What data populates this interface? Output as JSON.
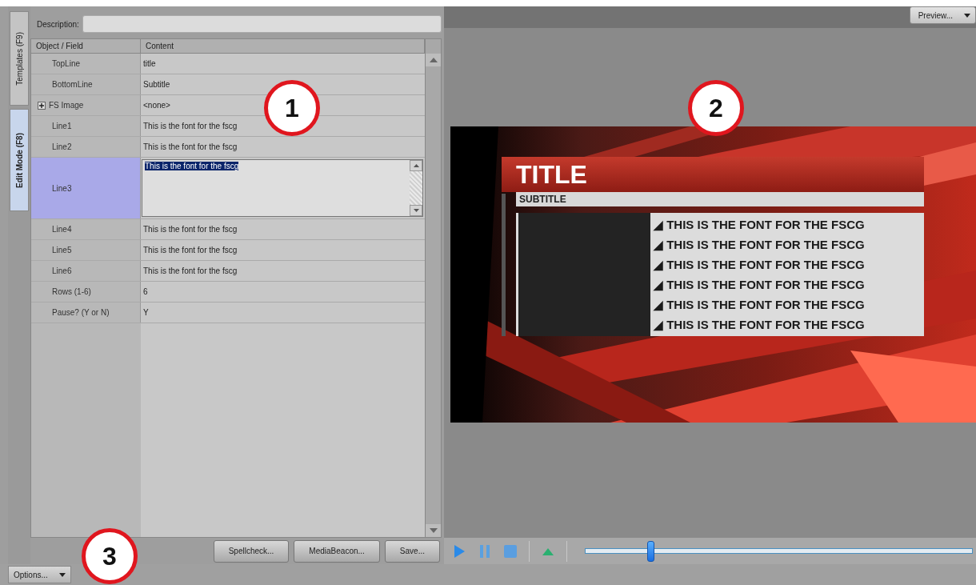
{
  "side_tabs": [
    {
      "label": "Templates (F9)",
      "selected": false
    },
    {
      "label": "Edit Mode (F8)",
      "selected": true
    }
  ],
  "description": {
    "label": "Description:"
  },
  "table": {
    "columns": [
      "Object / Field",
      "Content"
    ],
    "rows": [
      {
        "field": "TopLine",
        "content": "title",
        "kind": "text",
        "selected": false
      },
      {
        "field": "BottomLine",
        "content": "Subtitle",
        "kind": "text",
        "selected": false
      },
      {
        "field": "FS Image",
        "content": "<none>",
        "kind": "expandable",
        "expanded": false,
        "selected": false
      },
      {
        "field": "Line1",
        "content": "This is the font for the fscg",
        "kind": "text",
        "selected": false
      },
      {
        "field": "Line2",
        "content": "This is the font for the fscg",
        "kind": "text",
        "selected": false
      },
      {
        "field": "Line3",
        "content": "This is the font for the fscg",
        "kind": "multiline",
        "selected": true
      },
      {
        "field": "Line4",
        "content": "This is the font for the fscg",
        "kind": "text",
        "selected": false
      },
      {
        "field": "Line5",
        "content": "This is the font for the fscg",
        "kind": "text",
        "selected": false
      },
      {
        "field": "Line6",
        "content": "This is the font for the fscg",
        "kind": "text",
        "selected": false
      },
      {
        "field": "Rows (1-6)",
        "content": "6",
        "kind": "text",
        "selected": false
      },
      {
        "field": "Pause? (Y or N)",
        "content": "Y",
        "kind": "text",
        "selected": false
      }
    ]
  },
  "actions": [
    "Spellcheck...",
    "MediaBeacon...",
    "Save..."
  ],
  "options_button": "Options...",
  "preview_button": "Preview...",
  "preview": {
    "kind": "picture",
    "title": "TITLE",
    "subtitle": "SUBTITLE",
    "bullet": "◢",
    "lines": [
      "THIS IS THE FONT FOR THE FSCG",
      "THIS IS THE FONT FOR THE FSCG",
      "THIS IS THE FONT FOR THE FSCG",
      "THIS IS THE FONT FOR THE FSCG",
      "THIS IS THE FONT FOR THE FSCG",
      "THIS IS THE FONT FOR THE FSCG"
    ]
  },
  "transport": {
    "position": {
      "level": 0.17
    }
  },
  "callouts": [
    "1",
    "2",
    "3"
  ]
}
